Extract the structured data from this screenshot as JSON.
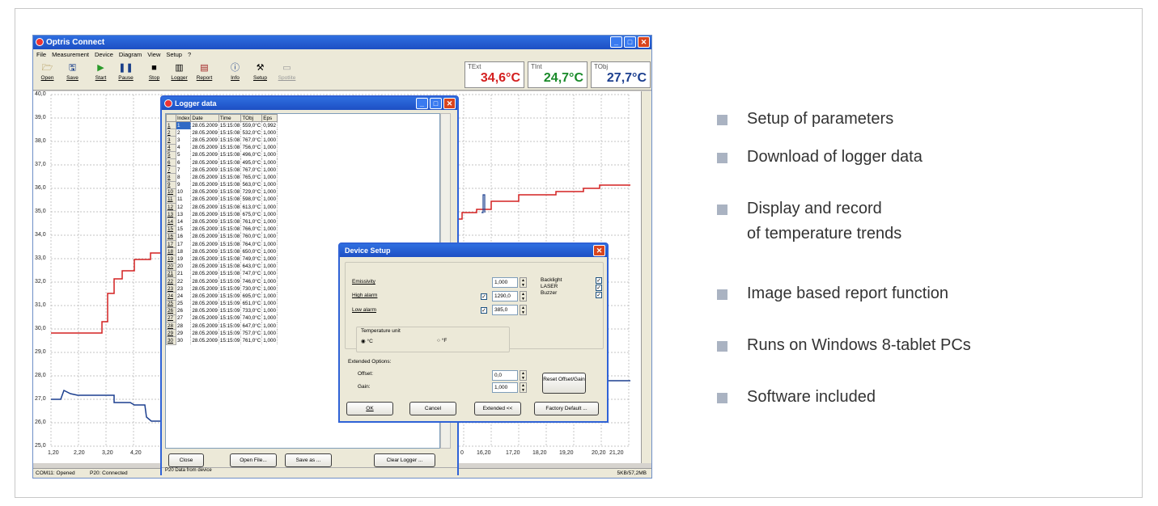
{
  "app": {
    "title": "Optris Connect",
    "menu": [
      "File",
      "Measurement",
      "Device",
      "Diagram",
      "View",
      "Setup",
      "?"
    ],
    "toolbar": [
      {
        "label": "Open",
        "icon": "folder-icon"
      },
      {
        "label": "Save",
        "icon": "floppy-icon"
      },
      {
        "label": "Start",
        "icon": "play-icon"
      },
      {
        "label": "Pause",
        "icon": "pause-icon"
      },
      {
        "label": "Stop",
        "icon": "stop-icon"
      },
      {
        "label": "Logger",
        "icon": "logger-icon"
      },
      {
        "label": "Report",
        "icon": "report-icon"
      },
      {
        "label": "Info",
        "icon": "info-icon"
      },
      {
        "label": "Setup",
        "icon": "tools-icon"
      },
      {
        "label": "Spotlite",
        "icon": "spotlite-icon"
      }
    ],
    "temps": [
      {
        "name": "TExt",
        "value": "34,6°C",
        "color": "#d42020"
      },
      {
        "name": "TInt",
        "value": "24,7°C",
        "color": "#1a8a2a"
      },
      {
        "name": "TObj",
        "value": "27,7°C",
        "color": "#1c3f8f"
      }
    ],
    "y_ticks": [
      "40,0",
      "39,0",
      "38,0",
      "37,0",
      "36,0",
      "35,0",
      "34,0",
      "33,0",
      "32,0",
      "31,0",
      "30,0",
      "29,0",
      "28,0",
      "27,0",
      "26,0",
      "25,0"
    ],
    "x_ticks_left": [
      "1,20",
      "2,20",
      "3,20",
      "4,20"
    ],
    "x_ticks_right": [
      "0",
      "16,20",
      "17,20",
      "18,20",
      "19,20",
      "20,20",
      "21,20"
    ],
    "status": {
      "port": "COM11: Opened",
      "device": "P20: Connected",
      "mem": "5KB/57,2MB"
    }
  },
  "logger": {
    "title": "Logger data",
    "columns": [
      "Index",
      "Date",
      "Time",
      "TObj",
      "Eps"
    ],
    "rows": [
      [
        "1",
        "1",
        "28.05.2009",
        "15:15:08",
        "559,0°C",
        "0,992"
      ],
      [
        "2",
        "2",
        "28.05.2009",
        "15:15:08",
        "532,0°C",
        "1,000"
      ],
      [
        "3",
        "3",
        "28.05.2009",
        "15:15:08",
        "767,0°C",
        "1,000"
      ],
      [
        "4",
        "4",
        "28.05.2009",
        "15:15:08",
        "756,0°C",
        "1,000"
      ],
      [
        "5",
        "5",
        "28.05.2009",
        "15:15:08",
        "496,0°C",
        "1,000"
      ],
      [
        "6",
        "6",
        "28.05.2009",
        "15:15:08",
        "495,0°C",
        "1,000"
      ],
      [
        "7",
        "7",
        "28.05.2009",
        "15:15:08",
        "767,0°C",
        "1,000"
      ],
      [
        "8",
        "8",
        "28.05.2009",
        "15:15:08",
        "765,0°C",
        "1,000"
      ],
      [
        "9",
        "9",
        "28.05.2009",
        "15:15:08",
        "563,0°C",
        "1,000"
      ],
      [
        "10",
        "10",
        "28.05.2009",
        "15:15:08",
        "729,0°C",
        "1,000"
      ],
      [
        "11",
        "11",
        "28.05.2009",
        "15:15:08",
        "598,0°C",
        "1,000"
      ],
      [
        "12",
        "12",
        "28.05.2009",
        "15:15:08",
        "613,0°C",
        "1,000"
      ],
      [
        "13",
        "13",
        "28.05.2009",
        "15:15:08",
        "675,0°C",
        "1,000"
      ],
      [
        "14",
        "14",
        "28.05.2009",
        "15:15:08",
        "761,0°C",
        "1,000"
      ],
      [
        "15",
        "15",
        "28.05.2009",
        "15:15:08",
        "766,0°C",
        "1,000"
      ],
      [
        "16",
        "16",
        "28.05.2009",
        "15:15:08",
        "760,0°C",
        "1,000"
      ],
      [
        "17",
        "17",
        "28.05.2009",
        "15:15:08",
        "764,0°C",
        "1,000"
      ],
      [
        "18",
        "18",
        "28.05.2009",
        "15:15:08",
        "650,0°C",
        "1,000"
      ],
      [
        "19",
        "19",
        "28.05.2009",
        "15:15:08",
        "749,0°C",
        "1,000"
      ],
      [
        "20",
        "20",
        "28.05.2009",
        "15:15:08",
        "643,0°C",
        "1,000"
      ],
      [
        "21",
        "21",
        "28.05.2009",
        "15:15:08",
        "747,0°C",
        "1,000"
      ],
      [
        "22",
        "22",
        "28.05.2009",
        "15:15:09",
        "746,0°C",
        "1,000"
      ],
      [
        "23",
        "23",
        "28.05.2009",
        "15:15:09",
        "730,0°C",
        "1,000"
      ],
      [
        "24",
        "24",
        "28.05.2009",
        "15:15:09",
        "695,0°C",
        "1,000"
      ],
      [
        "25",
        "25",
        "28.05.2009",
        "15:15:09",
        "651,0°C",
        "1,000"
      ],
      [
        "26",
        "26",
        "28.05.2009",
        "15:15:09",
        "733,0°C",
        "1,000"
      ],
      [
        "27",
        "27",
        "28.05.2009",
        "15:15:09",
        "740,0°C",
        "1,000"
      ],
      [
        "28",
        "28",
        "28.05.2009",
        "15:15:09",
        "647,0°C",
        "1,000"
      ],
      [
        "29",
        "29",
        "28.05.2009",
        "15:15:09",
        "757,0°C",
        "1,000"
      ],
      [
        "30",
        "30",
        "28.05.2009",
        "15:15:09",
        "761,0°C",
        "1,000"
      ]
    ],
    "buttons": {
      "close": "Close",
      "open": "Open File...",
      "save": "Save as ...",
      "clear": "Clear Logger ..."
    },
    "status": "P20 Data from device"
  },
  "device": {
    "title": "Device Setup",
    "emissivity_label": "Emissivity",
    "emissivity": "1,000",
    "high_alarm_label": "High alarm",
    "high_alarm": "1290,0",
    "low_alarm_label": "Low alarm",
    "low_alarm": "385,0",
    "backlight": "Backlight",
    "laser": "LASER",
    "buzzer": "Buzzer",
    "unit_label": "Temperature unit",
    "unit_c": "°C",
    "unit_f": "°F",
    "extended_label": "Extended Options:",
    "offset_label": "Offset:",
    "offset": "0,0",
    "gain_label": "Gain:",
    "gain": "1,000",
    "reset": "Reset Offset/Gain",
    "ok": "OK",
    "cancel": "Cancel",
    "extended": "Extended <<",
    "factory": "Factory Default ..."
  },
  "features": [
    "Setup of parameters",
    "Download of logger data",
    "Display and record",
    "of temperature trends",
    "Image based report function",
    "Runs on Windows 8-tablet PCs",
    "Software included"
  ]
}
